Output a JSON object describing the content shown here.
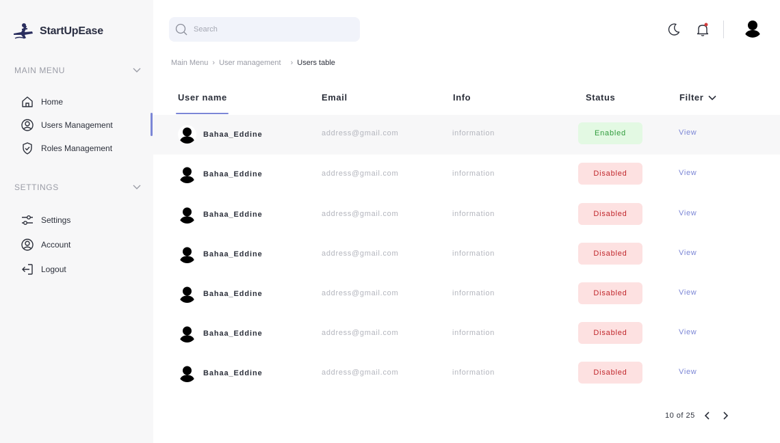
{
  "brand": {
    "name": "StartUpEase"
  },
  "sidebar": {
    "main_menu_title": "MAIN MENU",
    "settings_title": "SETTINGS",
    "main_items": [
      {
        "label": "Home",
        "icon": "home-icon"
      },
      {
        "label": "Users Management",
        "icon": "user-circle-icon"
      },
      {
        "label": "Roles Management",
        "icon": "shield-check-icon"
      }
    ],
    "settings_items": [
      {
        "label": "Settings",
        "icon": "sliders-icon"
      },
      {
        "label": "Account",
        "icon": "user-circle-icon"
      },
      {
        "label": "Logout",
        "icon": "logout-icon"
      }
    ],
    "active_item": "Users Management"
  },
  "search": {
    "placeholder": "Search",
    "value": ""
  },
  "header": {
    "icons": [
      "moon-icon",
      "bell-icon",
      "avatar"
    ],
    "notification_dot_color": "#d23b3b"
  },
  "breadcrumb": {
    "items": [
      "Main Menu",
      "User management",
      "Users table"
    ]
  },
  "table": {
    "columns": {
      "user": "User name",
      "email": "Email",
      "info": "Info",
      "status": "Status",
      "filter": "Filter"
    },
    "rows": [
      {
        "name": "Bahaa_Eddine",
        "email": "address@gmail.com",
        "info": "information",
        "status": "Enabled",
        "action": "View"
      },
      {
        "name": "Bahaa_Eddine",
        "email": "address@gmail.com",
        "info": "information",
        "status": "Disabled",
        "action": "View"
      },
      {
        "name": "Bahaa_Eddine",
        "email": "address@gmail.com",
        "info": "information",
        "status": "Disabled",
        "action": "View"
      },
      {
        "name": "Bahaa_Eddine",
        "email": "address@gmail.com",
        "info": "information",
        "status": "Disabled",
        "action": "View"
      },
      {
        "name": "Bahaa_Eddine",
        "email": "address@gmail.com",
        "info": "information",
        "status": "Disabled",
        "action": "View"
      },
      {
        "name": "Bahaa_Eddine",
        "email": "address@gmail.com",
        "info": "information",
        "status": "Disabled",
        "action": "View"
      },
      {
        "name": "Bahaa_Eddine",
        "email": "address@gmail.com",
        "info": "information",
        "status": "Disabled",
        "action": "View"
      }
    ]
  },
  "pagination": {
    "text": "10 of 25"
  },
  "colors": {
    "accent": "#7b86d6",
    "enabled_bg": "#e3f9e3",
    "enabled_text": "#2f9b3b",
    "disabled_bg": "#fde1e1",
    "disabled_text": "#c0262b"
  }
}
